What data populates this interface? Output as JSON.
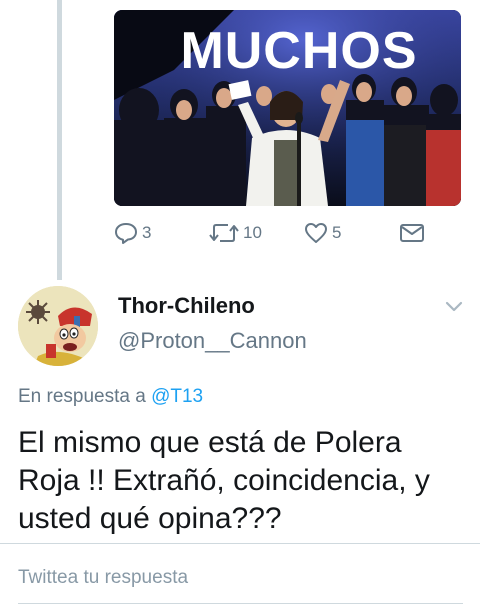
{
  "parent_tweet": {
    "media": {
      "sign_text": "MUCHOS"
    },
    "actions": {
      "reply_count": "3",
      "retweet_count": "10",
      "like_count": "5"
    }
  },
  "reply_tweet": {
    "display_name": "Thor-Chileno",
    "handle": "@Proton__Cannon",
    "in_reply_to_prefix": "En respuesta a",
    "in_reply_to_mention": "@T13",
    "text": "El mismo que está de Polera Roja !! Extrañó, coincidencia, y usted qué opina???"
  },
  "compose": {
    "placeholder": "Twittea tu respuesta"
  },
  "icons": {
    "reply": "reply-icon",
    "retweet": "retweet-icon",
    "like": "heart-icon",
    "dm": "envelope-icon",
    "menu": "chevron-down-icon"
  },
  "colors": {
    "accent": "#1da1f2",
    "secondary_text": "#657786",
    "divider": "#cfd9de"
  }
}
